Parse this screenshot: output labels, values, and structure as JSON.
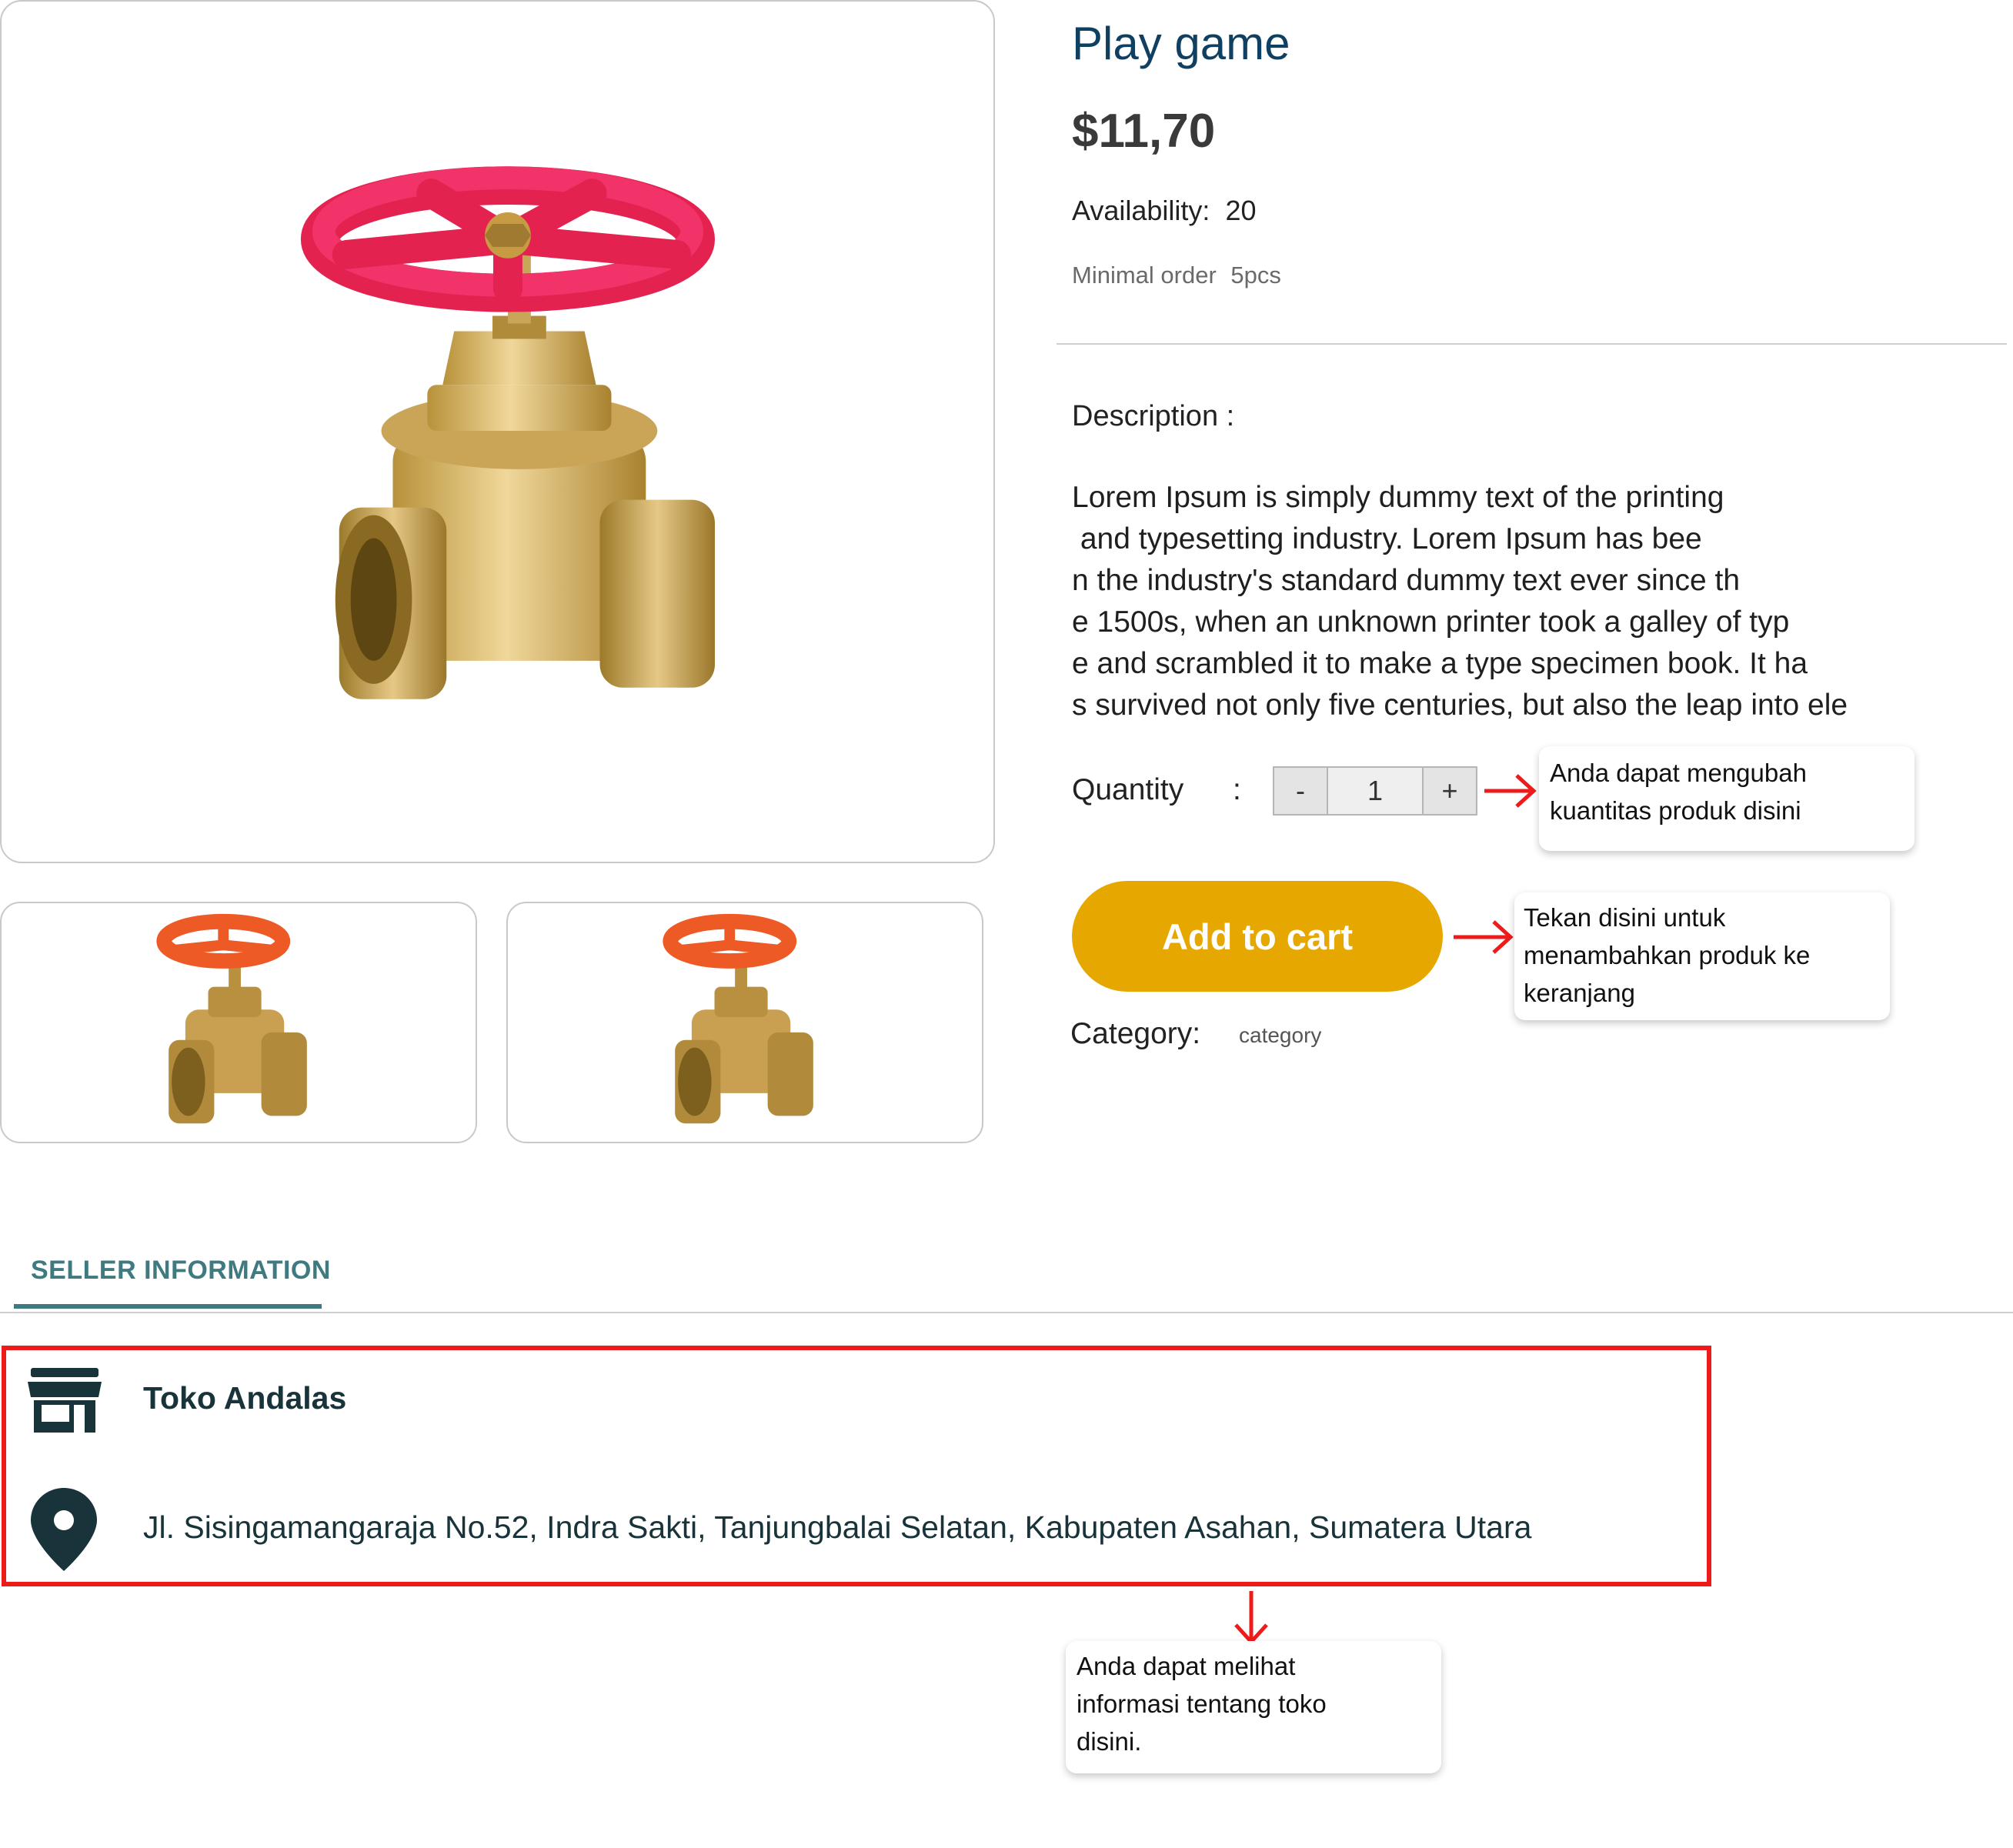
{
  "product": {
    "title": "Play game",
    "price": "$11,70",
    "availability_label": "Availability:",
    "availability_value": "20",
    "min_order_label": "Minimal order",
    "min_order_value": "5pcs",
    "description_label": "Description :",
    "description_lines": [
      "Lorem Ipsum is simply dummy text of the printing",
      " and typesetting industry. Lorem Ipsum has bee",
      "n the industry's standard dummy text ever since th",
      "e 1500s, when an unknown printer took a galley of typ",
      "e and scrambled it to make a type specimen book. It ha",
      "s survived not only five centuries, but also the leap into ele"
    ],
    "quantity_label": "Quantity",
    "quantity_colon": ":",
    "quantity_value": "1",
    "decrement_label": "-",
    "increment_label": "+",
    "add_to_cart_label": "Add to cart",
    "category_label": "Category:",
    "category_value": "category"
  },
  "tooltips": {
    "quantity": [
      "Anda dapat mengubah",
      "kuantitas produk disini"
    ],
    "cart": [
      "Tekan disini untuk",
      "menambahkan produk ke",
      "keranjang"
    ],
    "seller": [
      "Anda dapat melihat",
      "informasi tentang toko",
      "disini."
    ]
  },
  "seller": {
    "tab_label": "SELLER INFORMATION",
    "store_name": "Toko Andalas",
    "address": "Jl. Sisingamangaraja No.52, Indra Sakti, Tanjungbalai Selatan, Kabupaten Asahan, Sumatera Utara"
  },
  "colors": {
    "title": "#0f4061",
    "cart_button": "#e6a800",
    "accent_tab": "#3e7a80",
    "annotation_red": "#ee1b1b",
    "icon_dark": "#18333a"
  },
  "icons": {
    "store": "store-icon",
    "location": "location-pin-icon",
    "arrow": "arrow-annotation-icon"
  }
}
